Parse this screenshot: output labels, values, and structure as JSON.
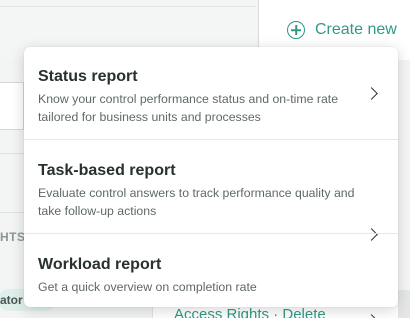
{
  "create_button": {
    "label": "Create new",
    "icon": "plus-circle-icon"
  },
  "background": {
    "section_label": "HTS",
    "chip_label": "ator",
    "link_text": "Access Rights · Delete"
  },
  "menu": {
    "items": [
      {
        "title": "Status report",
        "description": "Know your control performance status and on-time rate tailored for business units and processes",
        "icon": "chevron-right-icon"
      },
      {
        "title": "Task-based report",
        "description": "Evaluate control answers to track performance quality and take follow-up actions",
        "icon": "chevron-right-icon"
      },
      {
        "title": "Workload report",
        "description": "Get a quick overview on completion rate",
        "icon": "chevron-right-icon"
      }
    ]
  },
  "colors": {
    "accent": "#2f9a86",
    "text_primary": "#283030",
    "text_secondary": "#5f6868",
    "background": "#f3f4f4"
  }
}
